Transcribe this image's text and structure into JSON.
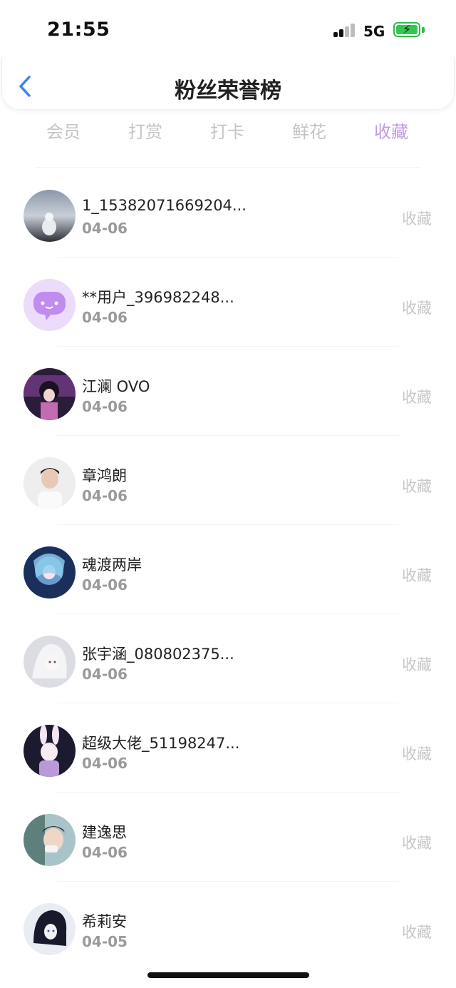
{
  "status_bar": {
    "time": "21:55",
    "network": "5G",
    "battery_charging_icon": "bolt-icon"
  },
  "header": {
    "title": "粉丝荣誉榜",
    "back_icon": "chevron-left-icon"
  },
  "tabs": [
    {
      "label": "会员",
      "active": false
    },
    {
      "label": "打赏",
      "active": false
    },
    {
      "label": "打卡",
      "active": false
    },
    {
      "label": "鲜花",
      "active": false
    },
    {
      "label": "收藏",
      "active": true
    }
  ],
  "colors": {
    "accent": "#c199e6",
    "back_icon": "#3b82f6",
    "battery": "#33c653"
  },
  "list": [
    {
      "name": "1_15382071669204...",
      "date": "04-06",
      "action": "收藏"
    },
    {
      "name": "**用户_396982248...",
      "date": "04-06",
      "action": "收藏"
    },
    {
      "name": "江澜 OVO",
      "date": "04-06",
      "action": "收藏"
    },
    {
      "name": "章鸿朗",
      "date": "04-06",
      "action": "收藏"
    },
    {
      "name": "魂渡两岸",
      "date": "04-06",
      "action": "收藏"
    },
    {
      "name": "张宇涵_080802375...",
      "date": "04-06",
      "action": "收藏"
    },
    {
      "name": "超级大佬_51198247...",
      "date": "04-06",
      "action": "收藏"
    },
    {
      "name": "建逸思",
      "date": "04-06",
      "action": "收藏"
    },
    {
      "name": "希莉安",
      "date": "04-05",
      "action": "收藏"
    }
  ]
}
